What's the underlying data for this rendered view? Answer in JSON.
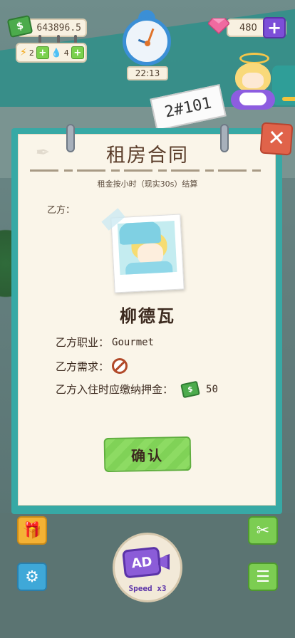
{
  "hud": {
    "cash": "643896.5",
    "energy": "2",
    "water": "4",
    "clock_time": "22:13",
    "gems": "480",
    "room_number": "2#101"
  },
  "contract": {
    "title": "租房合同",
    "subtitle": "租金按小时（现实30s）结算",
    "party_b_label": "乙方：",
    "tenant_name": "柳德瓦",
    "occupation_label": "乙方职业：",
    "occupation_value": "Gourmet",
    "demand_label": "乙方需求：",
    "deposit_label": "乙方入住时应缴纳押金：",
    "deposit_value": "50",
    "confirm_label": "确认"
  },
  "bottom": {
    "ad_label": "AD",
    "speed_label": "Speed x3"
  },
  "colors": {
    "frame": "#37a9a5",
    "paper": "#faf5e9",
    "confirm": "#8ddb63",
    "close": "#e0634a",
    "ad": "#8b5cd8"
  }
}
